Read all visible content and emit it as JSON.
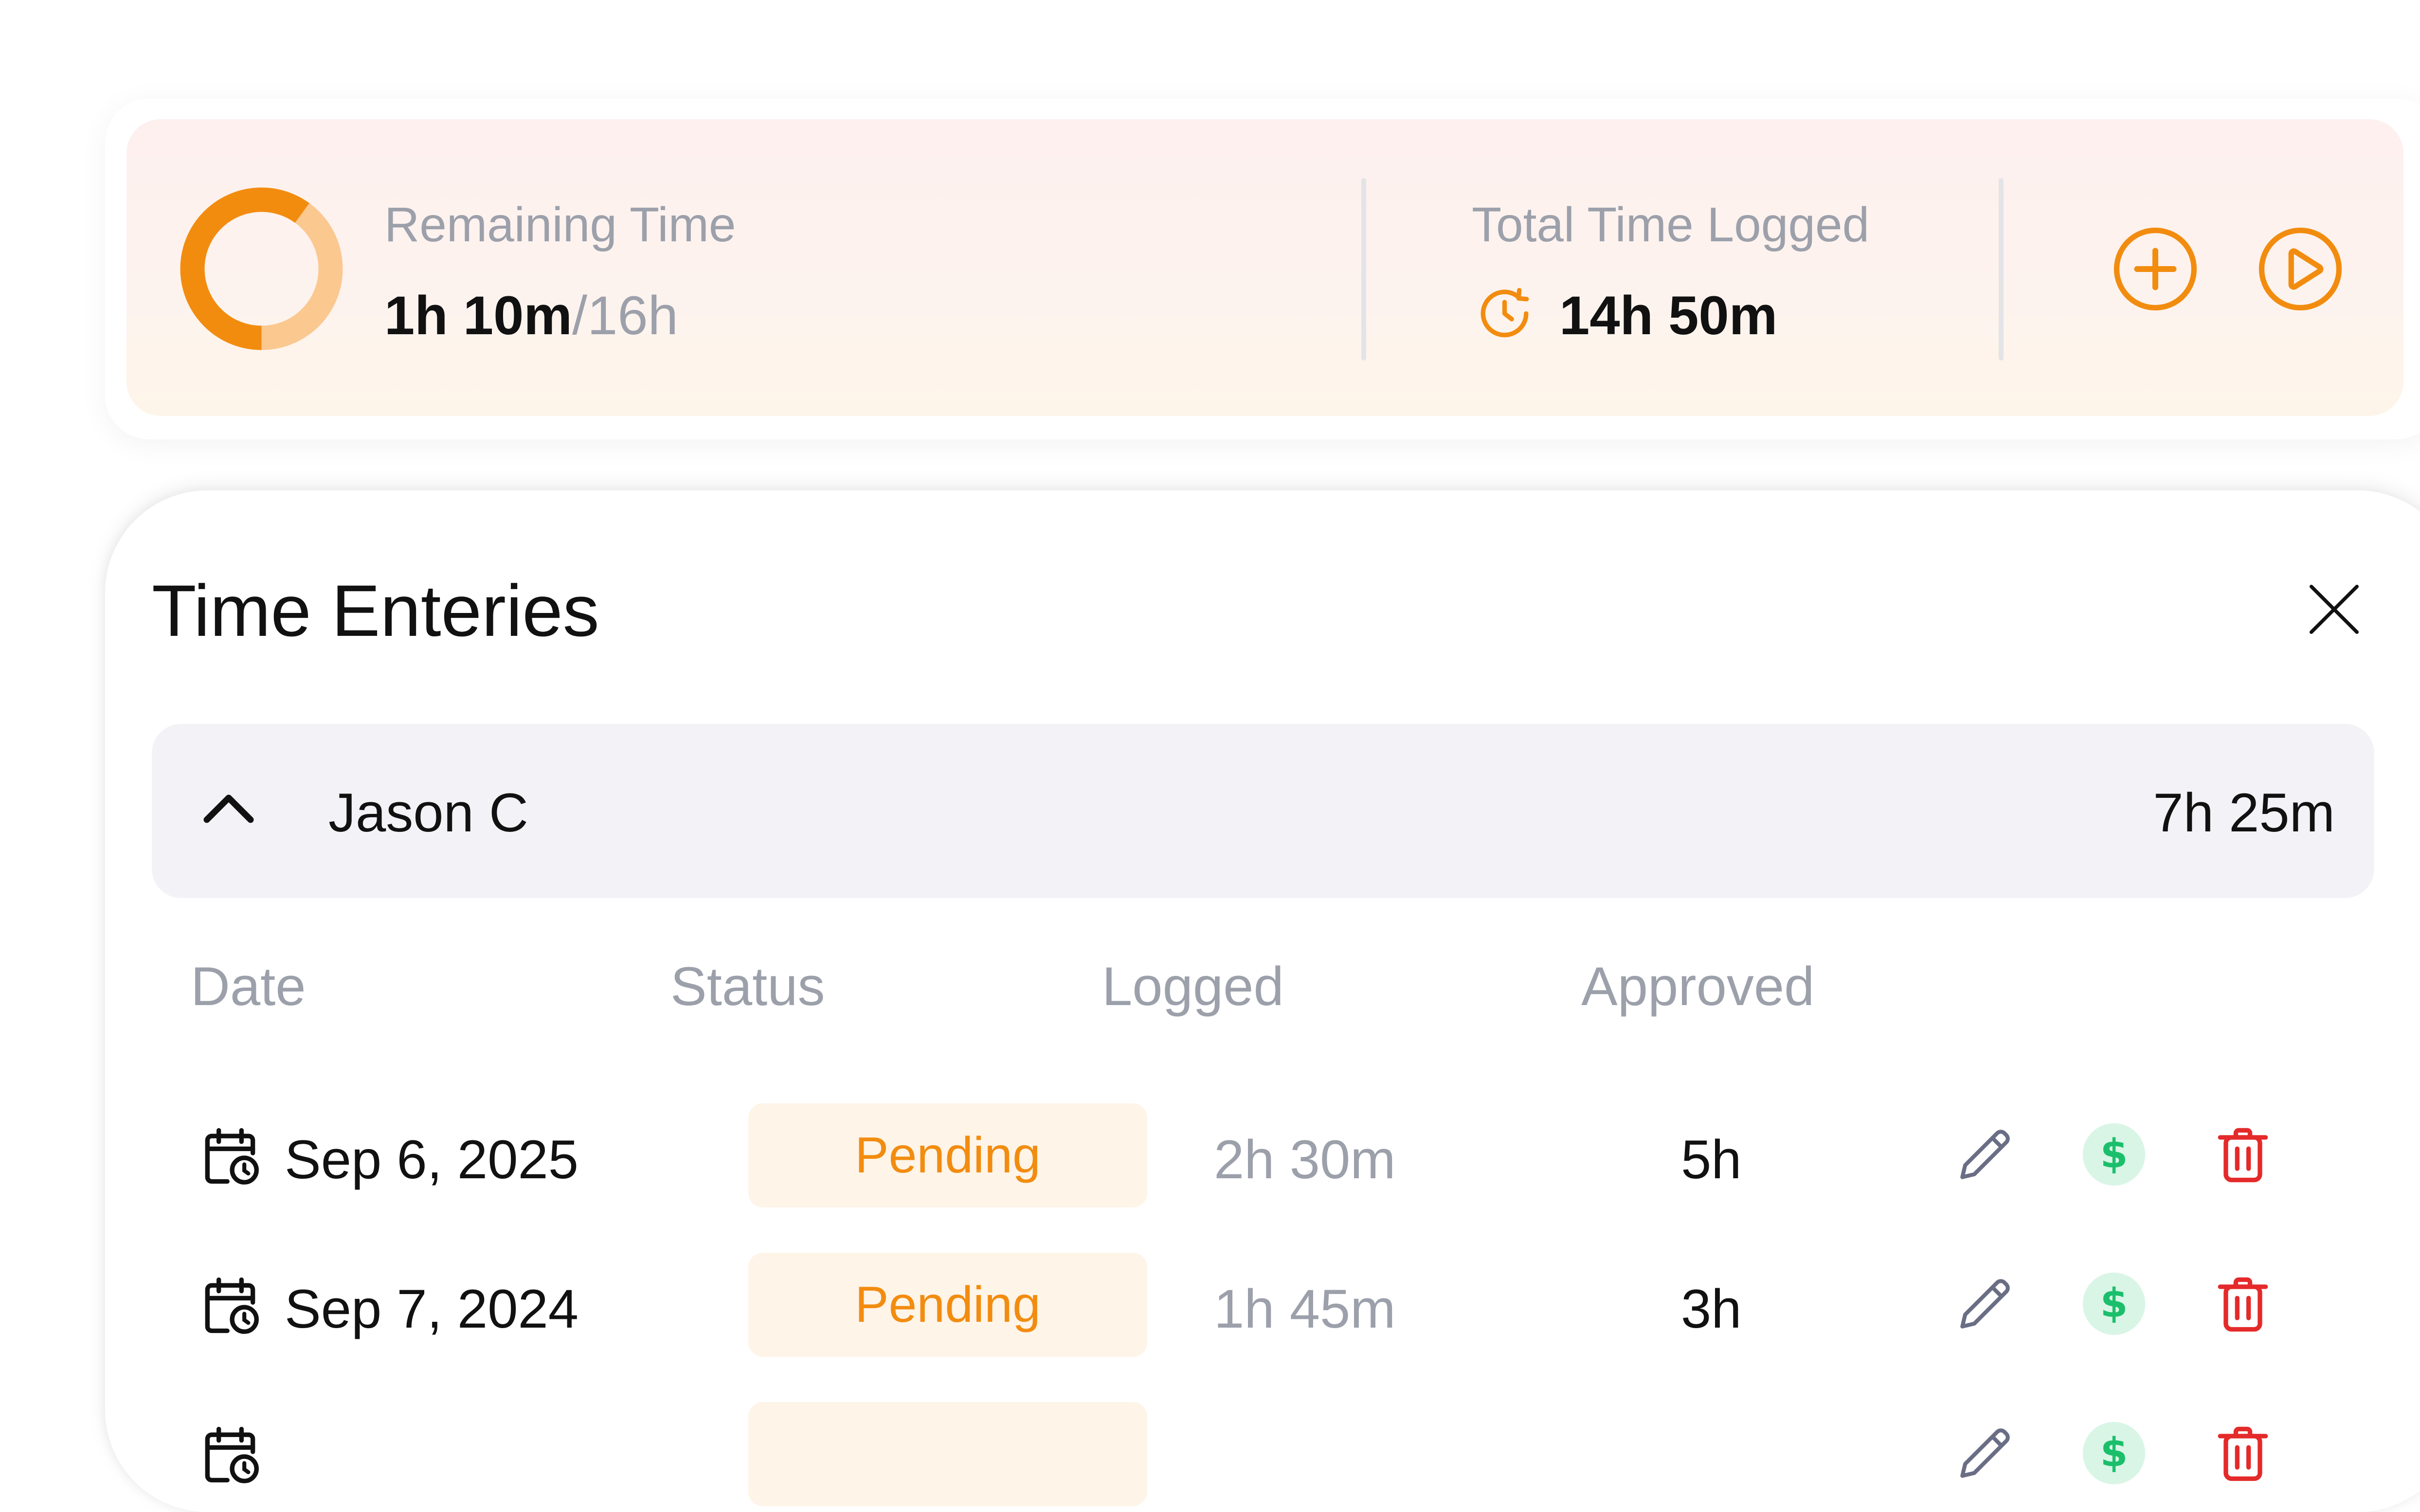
{
  "summary": {
    "remaining_label": "Remaining Time",
    "remaining_value": "1h 10m",
    "remaining_total": "/16h",
    "remaining_fraction": 0.6,
    "total_label": "Total Time Logged",
    "total_value": "14h 50m"
  },
  "panel": {
    "title": "Time Enteries"
  },
  "group": {
    "name": "Jason C",
    "total": "7h 25m",
    "expanded": true
  },
  "columns": {
    "date": "Date",
    "status": "Status",
    "logged": "Logged",
    "approved": "Approved"
  },
  "rows": [
    {
      "date": "Sep 6, 2025",
      "status": "Pending",
      "logged": "2h 30m",
      "approved": "5h"
    },
    {
      "date": "Sep 7, 2024",
      "status": "Pending",
      "logged": "1h 45m",
      "approved": "3h"
    },
    {
      "date": "",
      "status": "",
      "logged": "",
      "approved": ""
    }
  ],
  "colors": {
    "accent": "#f28c0f",
    "ring_light": "#fbc890",
    "danger": "#e42a2a",
    "money": "#1bbf6b",
    "money_bg": "#d9f5e6",
    "edit": "#6a6e85"
  },
  "icons": {
    "ring": "progress-ring-icon",
    "clock": "clock-refresh-icon",
    "add": "plus-circle-icon",
    "play": "play-circle-icon",
    "close": "close-icon",
    "collapse": "chevron-up-icon",
    "calendar": "calendar-clock-icon",
    "edit": "pencil-icon",
    "billable": "dollar-icon",
    "delete": "trash-icon"
  }
}
